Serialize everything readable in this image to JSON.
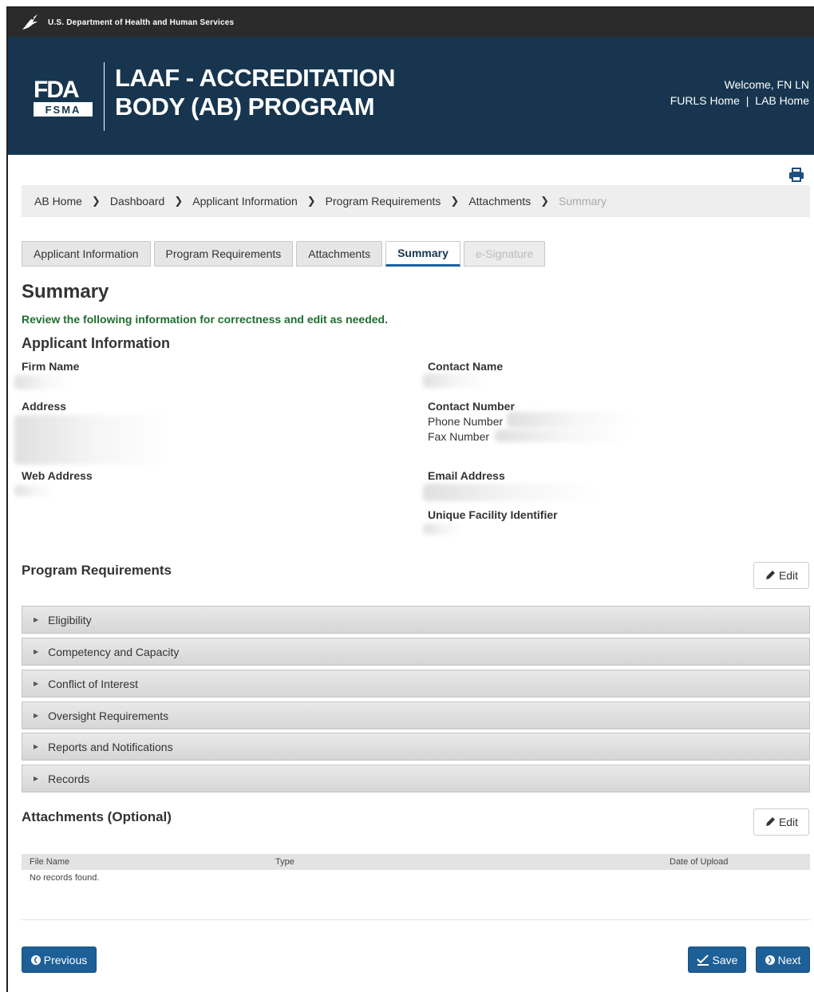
{
  "hhs": {
    "label": "U.S. Department of Health and Human Services"
  },
  "banner": {
    "logo_fda": "FDA",
    "logo_fsma": "FSMA",
    "title_line1": "LAAF - ACCREDITATION",
    "title_line2": "BODY (AB) PROGRAM",
    "welcome": "Welcome, FN LN",
    "link_furls": "FURLS Home",
    "link_sep": "|",
    "link_lab": "LAB Home"
  },
  "breadcrumb": {
    "items": [
      "AB Home",
      "Dashboard",
      "Applicant Information",
      "Program Requirements",
      "Attachments",
      "Summary"
    ]
  },
  "tabs": [
    "Applicant Information",
    "Program Requirements",
    "Attachments",
    "Summary",
    "e-Signature"
  ],
  "page": {
    "title": "Summary",
    "intro": "Review the following information for correctness and edit as needed."
  },
  "applicant": {
    "heading": "Applicant Information",
    "firm_name": "Firm Name",
    "address": "Address",
    "web_address": "Web Address",
    "contact_name": "Contact Name",
    "contact_number": "Contact Number",
    "phone_number": "Phone Number",
    "fax_number": "Fax Number",
    "email_address": "Email Address",
    "ufi": "Unique Facility Identifier"
  },
  "program": {
    "heading": "Program Requirements",
    "edit": "Edit",
    "sections": [
      "Eligibility",
      "Competency and Capacity",
      "Conflict of Interest",
      "Oversight Requirements",
      "Reports and Notifications",
      "Records"
    ]
  },
  "attachments": {
    "heading": "Attachments (Optional)",
    "edit": "Edit",
    "columns": [
      "File Name",
      "Type",
      "Date of Upload"
    ],
    "empty": "No records found."
  },
  "footer": {
    "previous": "Previous",
    "save": "Save",
    "next": "Next"
  },
  "colors": {
    "banner": "#17354e",
    "button": "#1d5f97",
    "intro": "#1f6e2f"
  }
}
